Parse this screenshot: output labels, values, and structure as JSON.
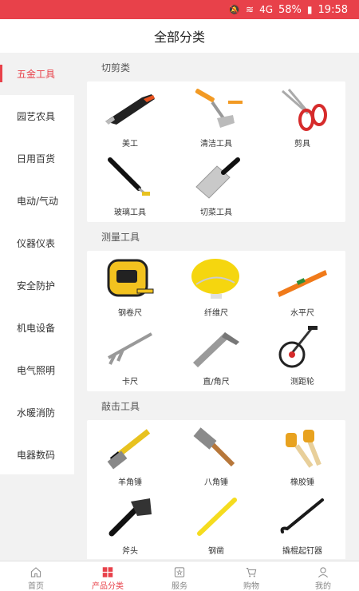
{
  "status": {
    "battery": "58%",
    "time": "19:58",
    "signal": "4G"
  },
  "header": {
    "title": "全部分类"
  },
  "sidebar": {
    "items": [
      {
        "label": "五金工具",
        "active": true
      },
      {
        "label": "园艺农具"
      },
      {
        "label": "日用百货"
      },
      {
        "label": "电动/气动"
      },
      {
        "label": "仪器仪表"
      },
      {
        "label": "安全防护"
      },
      {
        "label": "机电设备"
      },
      {
        "label": "电气照明"
      },
      {
        "label": "水暖消防"
      },
      {
        "label": "电器数码"
      }
    ]
  },
  "sections": [
    {
      "title": "切剪类",
      "items": [
        {
          "label": "美工",
          "icon": "utility-knife-icon"
        },
        {
          "label": "清洁工具",
          "icon": "scraper-icon"
        },
        {
          "label": "剪具",
          "icon": "scissors-icon"
        },
        {
          "label": "玻璃工具",
          "icon": "glass-cutter-icon"
        },
        {
          "label": "切菜工具",
          "icon": "cleaver-icon"
        }
      ]
    },
    {
      "title": "测量工具",
      "items": [
        {
          "label": "钢卷尺",
          "icon": "tape-measure-icon"
        },
        {
          "label": "纤维尺",
          "icon": "fiber-tape-icon"
        },
        {
          "label": "水平尺",
          "icon": "level-icon"
        },
        {
          "label": "卡尺",
          "icon": "caliper-icon"
        },
        {
          "label": "直/角尺",
          "icon": "square-ruler-icon"
        },
        {
          "label": "测距轮",
          "icon": "measuring-wheel-icon"
        }
      ]
    },
    {
      "title": "敲击工具",
      "items": [
        {
          "label": "羊角锤",
          "icon": "claw-hammer-icon"
        },
        {
          "label": "八角锤",
          "icon": "octagon-hammer-icon"
        },
        {
          "label": "橡胶锤",
          "icon": "rubber-mallet-icon"
        },
        {
          "label": "斧头",
          "icon": "axe-icon"
        },
        {
          "label": "钢凿",
          "icon": "chisel-icon"
        },
        {
          "label": "撬棍起钉器",
          "icon": "crowbar-icon"
        }
      ]
    }
  ],
  "tabbar": [
    {
      "label": "首页",
      "icon": "home-icon"
    },
    {
      "label": "产品分类",
      "icon": "category-icon",
      "active": true
    },
    {
      "label": "服务",
      "icon": "star-icon"
    },
    {
      "label": "购物",
      "icon": "cart-icon"
    },
    {
      "label": "我的",
      "icon": "user-icon"
    }
  ],
  "colors": {
    "accent": "#e8414a"
  }
}
